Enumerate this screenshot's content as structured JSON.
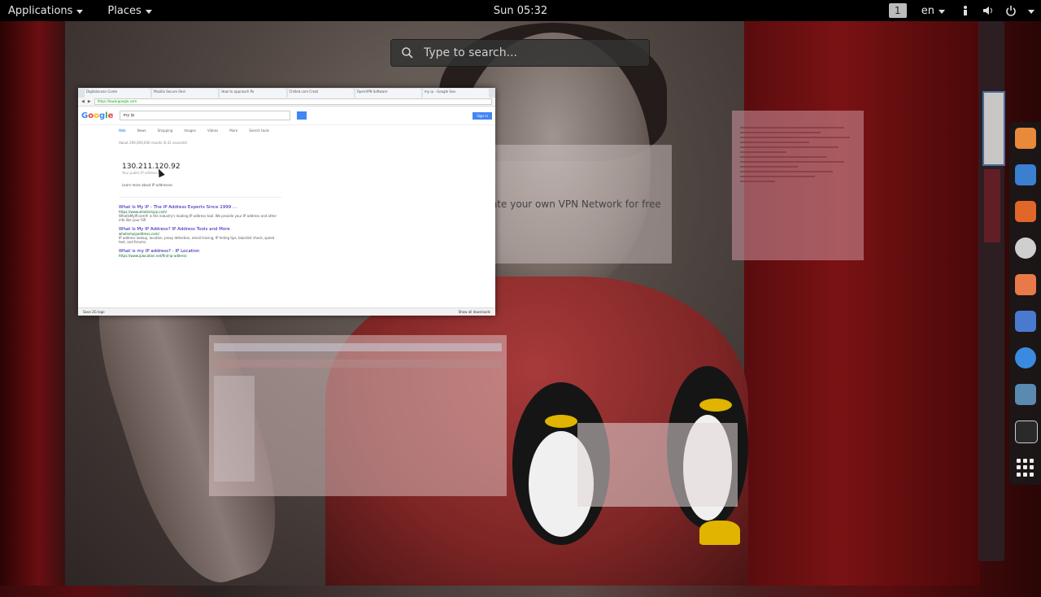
{
  "topbar": {
    "applications_label": "Applications",
    "places_label": "Places",
    "clock": "Sun 05:32",
    "workspace": "1",
    "language": "en",
    "icons": [
      "accessibility-icon",
      "volume-icon",
      "power-icon"
    ]
  },
  "search": {
    "placeholder": "Type to search..."
  },
  "browser": {
    "url": "https://www.google.com",
    "tabs": [
      "Digitalocean Conte",
      "Mozilla Secure Shel",
      "How to approach Po",
      "Chilled.com Creat",
      "OpenVPN Software",
      "my ip - Google Sea"
    ],
    "logo": "Google",
    "query": "my ip",
    "signin": "Sign in",
    "nav": [
      "Web",
      "News",
      "Shopping",
      "Images",
      "Videos",
      "More",
      "Search tools"
    ],
    "stats": "About 290,000,000 results (0.31 seconds)",
    "ip_value": "130.211.120.92",
    "ip_sub": "Your public IP address",
    "ip_learn": "Learn more about IP addresses",
    "results": [
      {
        "title": "What Is My IP - The IP Address Experts Since 1999 ...",
        "url": "https://www.whatismyip.com/",
        "text": "WhatIsMyIP.com® is the industry's leading IP address tool. We provide your IP address and other info like your ISP."
      },
      {
        "title": "What Is My IP Address? IP Address Tools and More",
        "url": "whatismyipaddress.com/",
        "text": "IP address lookup, location, proxy detection, email tracing, IP hiding tips, blacklist check, speed test, and forums."
      },
      {
        "title": "What is my IP address? - IP Location",
        "url": "https://www.iplocation.net/find-ip-address",
        "text": ""
      }
    ],
    "status_left": "Save 2G logo",
    "status_right": "Show all downloads"
  },
  "vpn_window": {
    "text": "ate your own VPN Network for free"
  },
  "dock": {
    "items": [
      "files-icon",
      "browser-icon",
      "firefox-icon",
      "software-icon",
      "document-icon",
      "network-icon",
      "thunderbird-icon",
      "editor-icon",
      "terminal-icon"
    ],
    "apps_grid": "show-applications-icon"
  }
}
